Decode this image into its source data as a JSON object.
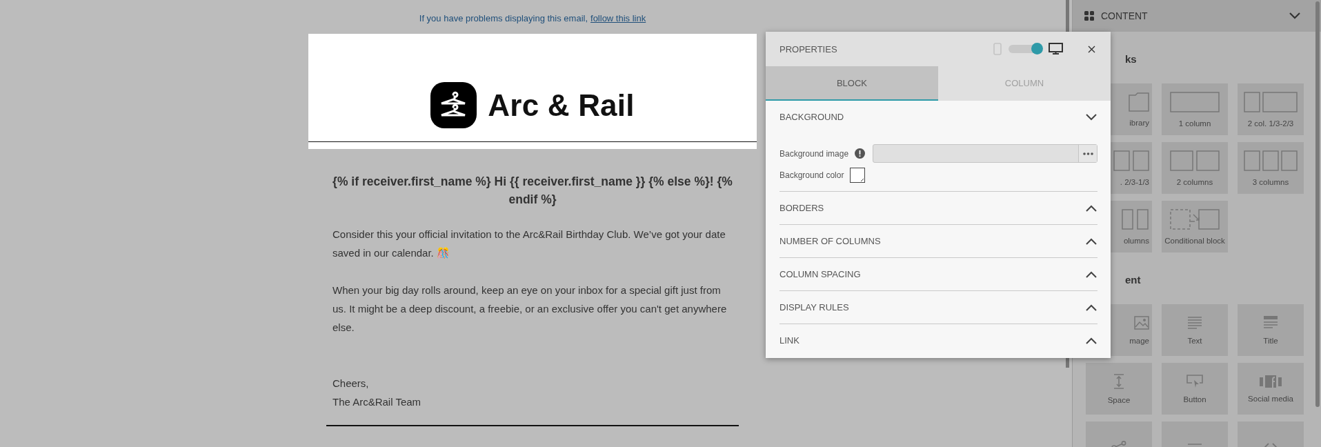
{
  "email": {
    "notice": "If you have problems displaying this email,",
    "notice_link": "follow this link",
    "brand": "Arc & Rail",
    "greeting": "{% if receiver.first_name %} Hi {{ receiver.first_name }} {% else %}! {% endif %}",
    "paragraphs": [
      "Consider this your official invitation to the Arc&Rail Birthday Club. We’ve got your date saved in our calendar. 🎊",
      "When your big day rolls around, keep an eye on your inbox for a special gift just from us. It might be a deep discount, a freebie, or an exclusive offer you can't get anywhere else."
    ],
    "signoff": [
      "Cheers,",
      "The Arc&Rail Team"
    ]
  },
  "properties": {
    "title": "PROPERTIES",
    "desktop_view": true,
    "tabs": [
      {
        "label": "BLOCK",
        "selected": true
      },
      {
        "label": "COLUMN",
        "selected": false
      }
    ],
    "sections": [
      {
        "title": "BACKGROUND",
        "expanded": true
      },
      {
        "title": "BORDERS",
        "expanded": false
      },
      {
        "title": "NUMBER OF COLUMNS",
        "expanded": false
      },
      {
        "title": "COLUMN SPACING",
        "expanded": false
      },
      {
        "title": "DISPLAY RULES",
        "expanded": false
      },
      {
        "title": "LINK",
        "expanded": false
      }
    ],
    "background_image_label": "Background image",
    "background_color_label": "Background color"
  },
  "sidebar": {
    "title": "CONTENT",
    "groups": [
      {
        "heading": "ks",
        "tiles": [
          {
            "kind": "library",
            "label": "ibrary"
          },
          {
            "kind": "col1",
            "label": "1 column"
          },
          {
            "kind": "col13",
            "label": "2 col. 1/3-2/3"
          },
          {
            "kind": "col31",
            "label": ". 2/3-1/3"
          },
          {
            "kind": "col2",
            "label": "2 columns"
          },
          {
            "kind": "col3",
            "label": "3 columns"
          },
          {
            "kind": "col4",
            "label": "olumns"
          },
          {
            "kind": "conditional",
            "label": "Conditional block"
          }
        ]
      },
      {
        "heading": "ent",
        "tiles": [
          {
            "kind": "image",
            "label": "mage"
          },
          {
            "kind": "text",
            "label": "Text"
          },
          {
            "kind": "title",
            "label": "Title"
          },
          {
            "kind": "space",
            "label": "Space"
          },
          {
            "kind": "button",
            "label": "Button"
          },
          {
            "kind": "social",
            "label": "Social media"
          },
          {
            "kind": "share"
          },
          {
            "kind": "divider"
          },
          {
            "kind": "html"
          }
        ]
      }
    ]
  }
}
